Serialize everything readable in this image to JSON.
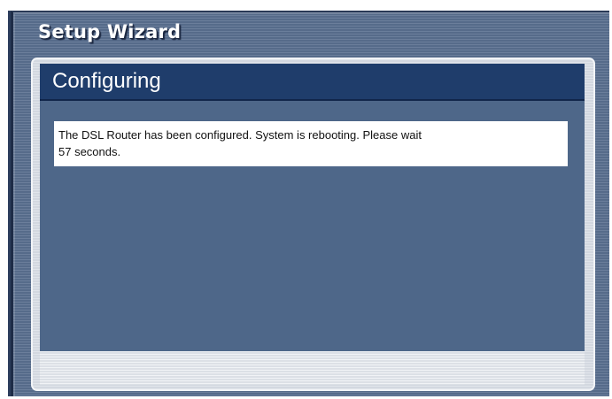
{
  "wizard": {
    "title": "Setup Wizard"
  },
  "panel": {
    "title": "Configuring",
    "message_line1": "The DSL Router has been configured. System is rebooting. Please wait",
    "message_line2": "57 seconds."
  },
  "colors": {
    "frame_background": "#5a6f90",
    "header_background": "#1f3d6b",
    "body_background": "#4e6789",
    "message_background": "#ffffff",
    "footer_background": "#e3e7ed"
  }
}
